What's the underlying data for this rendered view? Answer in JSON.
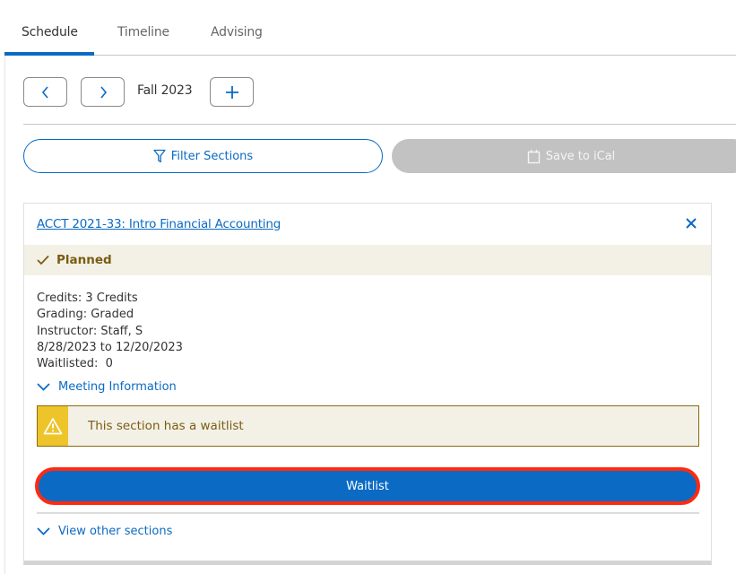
{
  "tabs": [
    {
      "label": "Schedule",
      "active": true
    },
    {
      "label": "Timeline",
      "active": false
    },
    {
      "label": "Advising",
      "active": false
    }
  ],
  "term_nav": {
    "prev_icon": "chevron-left-icon",
    "next_icon": "chevron-right-icon",
    "term": "Fall 2023",
    "add_icon": "plus-icon"
  },
  "actions": {
    "filter_label": "Filter Sections",
    "filter_icon": "filter-icon",
    "ical_label": "Save to iCal",
    "ical_icon": "calendar-icon",
    "ical_disabled": true
  },
  "course_card": {
    "title": "ACCT 2021-33: Intro Financial Accounting",
    "status": "Planned",
    "details": [
      "Credits: 3 Credits",
      "Grading: Graded",
      "Instructor: Staff, S",
      "8/28/2023 to 12/20/2023",
      "Waitlisted:  0"
    ],
    "meeting_info_label": "Meeting Information",
    "alert_text": "This section has a waitlist",
    "waitlist_button_label": "Waitlist",
    "view_other_label": "View other sections"
  },
  "colors": {
    "accent": "#0b6ac4",
    "status_bg": "#f3f0e6",
    "status_text": "#7a5d12",
    "warning": "#eec42b",
    "highlight": "#ff2a10",
    "disabled": "#c2c2c2"
  }
}
